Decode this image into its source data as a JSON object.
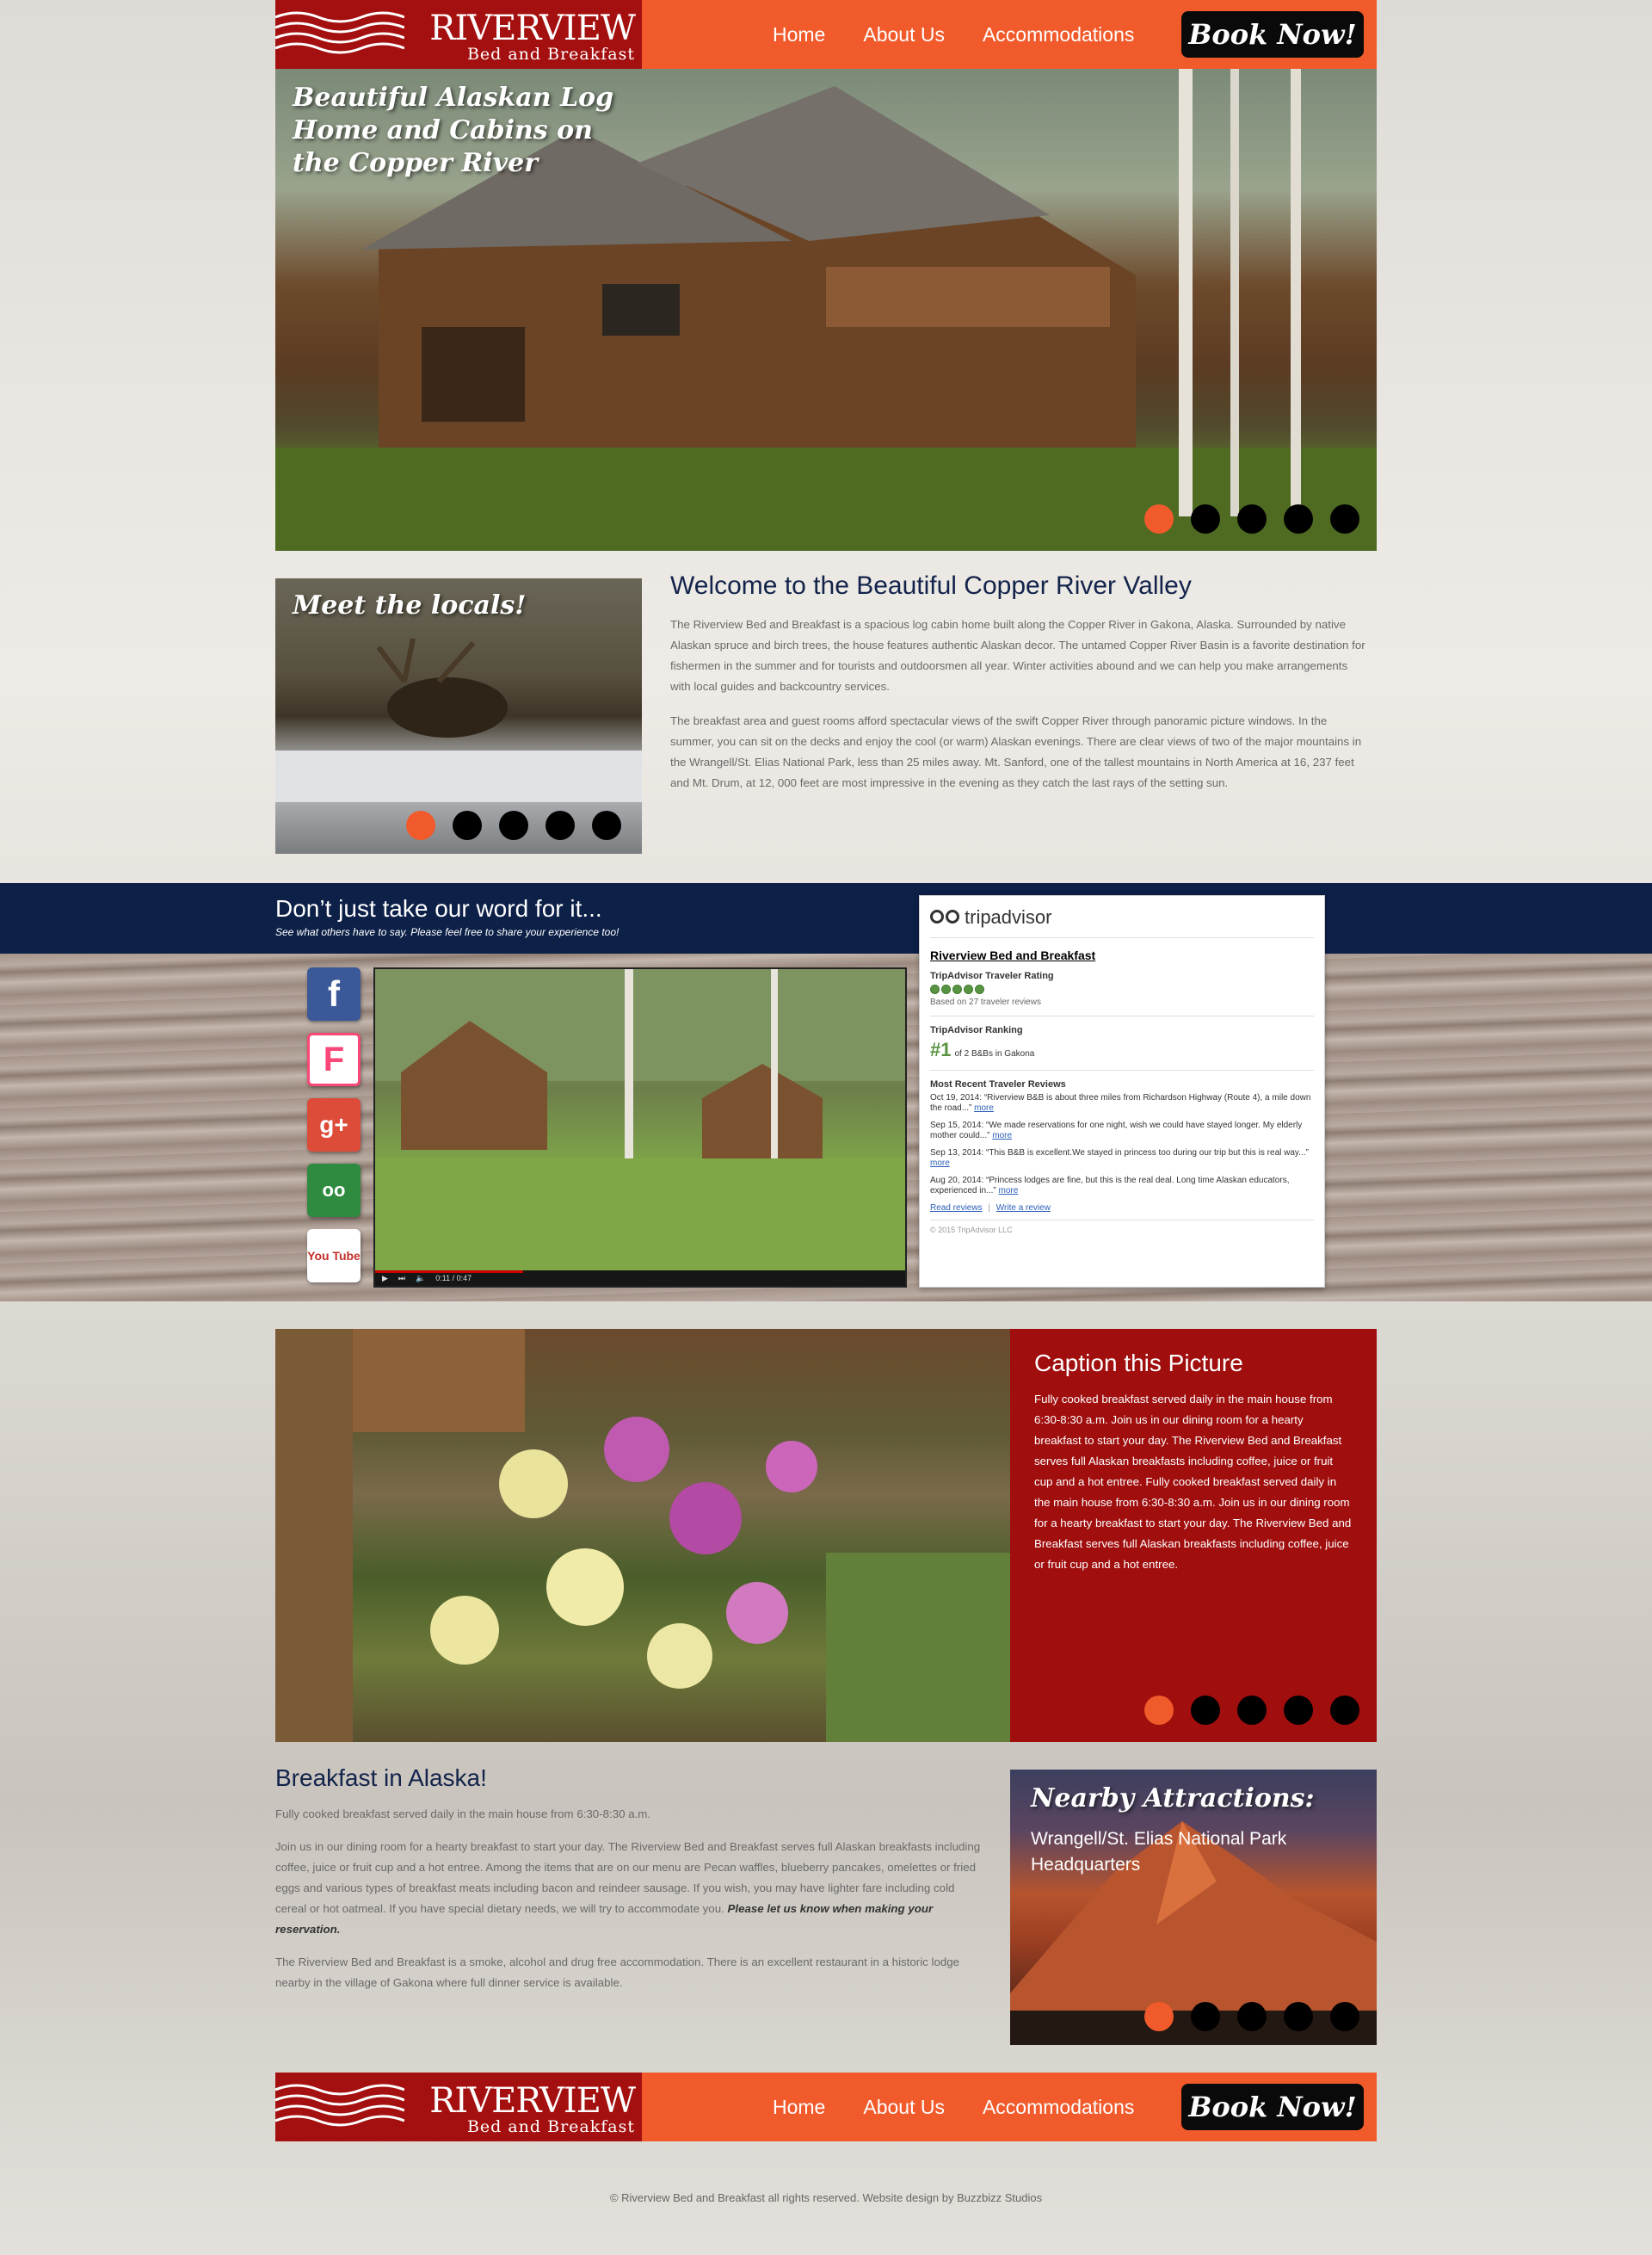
{
  "brand": {
    "name": "Riverview",
    "tagline": "Bed and Breakfast"
  },
  "nav": {
    "items": [
      "Home",
      "About Us",
      "Accommodations"
    ],
    "book_label": "Book Now!"
  },
  "hero": {
    "title": "Beautiful Alaskan Log Home and Cabins on the Copper River",
    "slides": 5,
    "active_slide": 1
  },
  "locals": {
    "title": "Meet the locals!",
    "slides": 5,
    "active_slide": 1
  },
  "welcome": {
    "heading": "Welcome to the Beautiful Copper River Valley",
    "paragraphs": [
      "The Riverview Bed and Breakfast is a spacious log cabin home built along the Copper River in Gakona, Alaska. Surrounded by native Alaskan spruce and birch trees, the house features authentic Alaskan decor. The untamed Copper River Basin is a favorite destination for fishermen in the summer and for tourists and outdoorsmen all year. Winter activities abound and we can help you make arrangements with local guides and backcountry services.",
      "The breakfast area and guest rooms afford spectacular views of the swift Copper River through panoramic picture windows. In the summer, you can sit on the decks and enjoy the cool (or warm) Alaskan evenings. There are clear views of two of the major mountains in the Wrangell/St. Elias National Park, less than 25 miles away. Mt. Sanford, one of the tallest mountains in North America at 16, 237 feet and Mt. Drum, at 12, 000 feet are most impressive in the evening as they catch the last rays of the setting sun."
    ]
  },
  "reviews": {
    "heading": "Don’t just take our word for it...",
    "subheading": "See what others have to say. Please feel free to share your experience too!",
    "social": [
      {
        "name": "facebook",
        "glyph": "f",
        "bg": "#3b5998",
        "fg": "#ffffff"
      },
      {
        "name": "foursquare",
        "glyph": "F",
        "bg": "#ffffff",
        "fg": "#f94877"
      },
      {
        "name": "google-plus",
        "glyph": "g+",
        "bg": "#dd4b39",
        "fg": "#ffffff"
      },
      {
        "name": "tripadvisor",
        "glyph": "oo",
        "bg": "#2e8b3f",
        "fg": "#ffffff"
      },
      {
        "name": "youtube",
        "glyph": "You Tube",
        "bg": "#ffffff",
        "fg": "#c4302b"
      }
    ],
    "video": {
      "time": "0:11 / 0:47",
      "progress": 0.28
    }
  },
  "tripadvisor": {
    "logo": "tripadvisor",
    "property": "Riverview Bed and Breakfast",
    "rating_label": "TripAdvisor Traveler Rating",
    "rating_bubbles": 5,
    "based_on": "Based on 27 traveler reviews",
    "ranking_label": "TripAdvisor Ranking",
    "rank": "#1",
    "rank_text": "of 2 B&Bs in Gakona",
    "recent_label": "Most Recent Traveler Reviews",
    "reviews": [
      {
        "text": "Oct 19, 2014: “Riverview B&B is about three miles from Richardson Highway (Route 4), a mile down the road...”",
        "more": "more"
      },
      {
        "text": "Sep 15, 2014: “We made reservations for one night, wish we could have stayed longer. My elderly mother could...”",
        "more": "more"
      },
      {
        "text": "Sep 13, 2014: “This B&B is excellent.We stayed in princess too during our trip but this is real way...”",
        "more": "more"
      },
      {
        "text": "Aug 20, 2014: “Princess lodges are fine, but this is the real deal. Long time Alaskan educators, experienced in...”",
        "more": "more"
      }
    ],
    "read_reviews": "Read reviews",
    "separator": "|",
    "write_review": "Write a review",
    "copyright": "© 2015 TripAdvisor LLC"
  },
  "caption": {
    "heading": "Caption this Picture",
    "text": "Fully cooked breakfast served daily in the main house from 6:30-8:30 a.m. Join us in our dining room for a hearty breakfast to start your day. The Riverview Bed and Breakfast serves full Alaskan breakfasts including coffee, juice or fruit cup and a hot entree. Fully cooked breakfast served daily in the main house from 6:30-8:30 a.m. Join us in our dining room for a hearty breakfast to start your day. The Riverview Bed and Breakfast serves full Alaskan breakfasts including coffee, juice or fruit cup and a hot entree.",
    "slides": 5,
    "active_slide": 1
  },
  "breakfast": {
    "heading": "Breakfast in Alaska!",
    "p1": "Fully cooked breakfast served daily in the main house from 6:30-8:30 a.m.",
    "p2": "Join us in our dining room for a hearty breakfast to start your day. The Riverview Bed and Breakfast serves full Alaskan breakfasts including coffee, juice or fruit cup and a hot entree. Among the items that are on our menu are Pecan waffles, blueberry pancakes, omelettes or fried eggs and various types of breakfast meats including bacon and reindeer sausage. If you wish, you may have lighter fare including cold cereal or hot oatmeal. If you have special dietary needs, we will try to accommodate you.",
    "p2_emphasis": "Please let us know when making your reservation.",
    "p3": "The Riverview Bed and Breakfast is a smoke, alcohol and drug free accommodation. There is an excellent restaurant in a historic lodge nearby in the village of Gakona where full dinner service is available."
  },
  "nearby": {
    "title": "Nearby Attractions:",
    "subtitle": "Wrangell/St. Elias National Park Headquarters",
    "slides": 5,
    "active_slide": 1
  },
  "footer": {
    "text": "© Riverview Bed and Breakfast all rights reserved. Website design by Buzzbizz Studios"
  },
  "colors": {
    "accent": "#f15a2b",
    "brand_red": "#a4100f",
    "navy": "#0d2048",
    "button": "#0a0a0a"
  }
}
